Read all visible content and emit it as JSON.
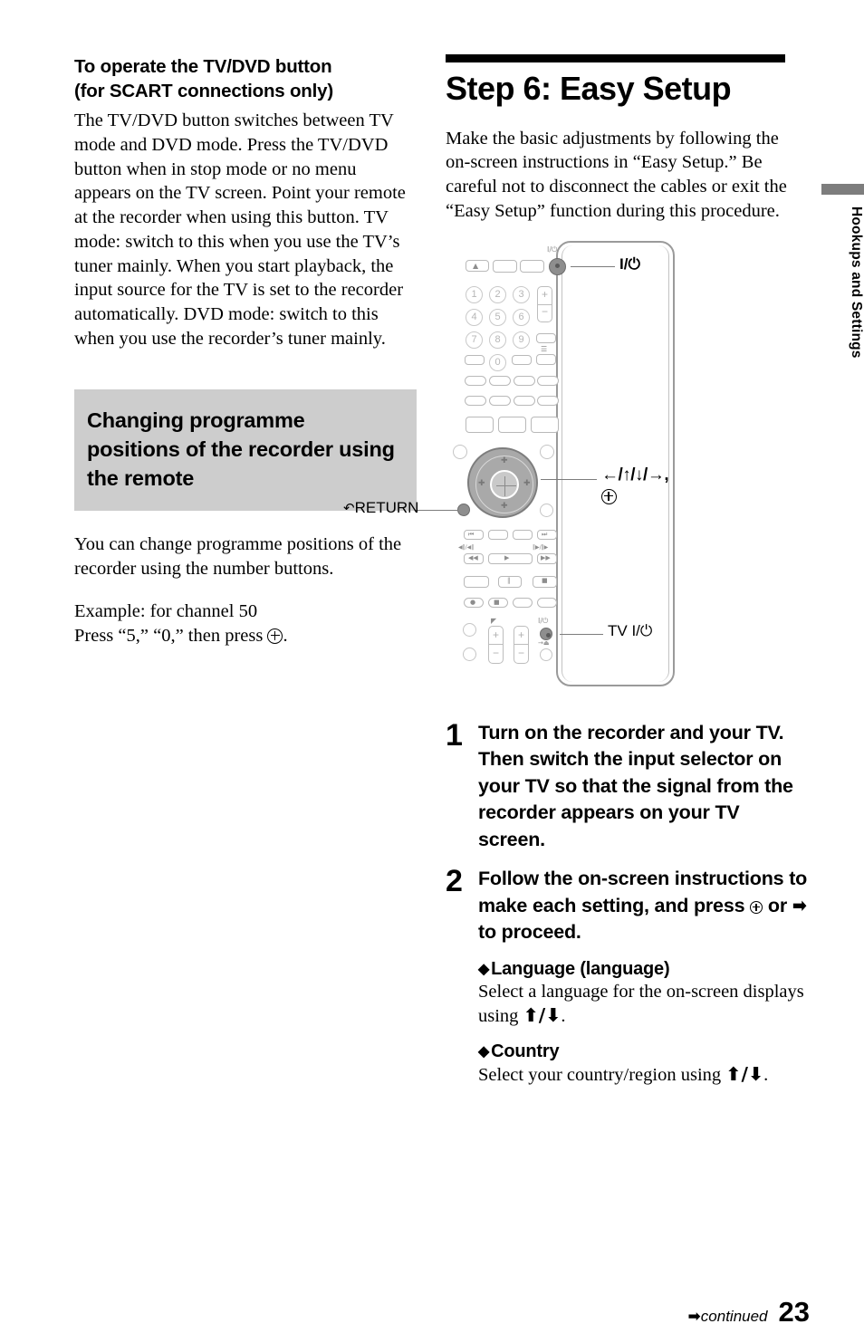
{
  "left_column": {
    "heading_line1": "To operate the TV/DVD button",
    "heading_line2": "(for SCART connections only)",
    "body": "The TV/DVD button switches between TV mode and DVD mode. Press the TV/DVD button when in stop mode or no menu appears on the TV screen. Point your remote at the recorder when using this button. TV mode: switch to this when you use the TV’s tuner mainly. When you start playback, the input source for the TV is set to the recorder automatically. DVD mode: switch to this when you use the recorder’s tuner mainly.",
    "gray_box_title": "Changing programme positions of the recorder using the remote",
    "after_box_para": "You can change programme positions of the recorder using the number buttons.",
    "example_line1": "Example: for channel 50",
    "example_line2_pre": "Press “5,” “0,” then press ",
    "example_line2_post": "."
  },
  "right_column": {
    "step_title": "Step 6: Easy Setup",
    "intro": "Make the basic adjustments by following the on-screen instructions in “Easy Setup.” Be careful not to disconnect the cables or exit the “Easy Setup” function during this procedure."
  },
  "figure": {
    "callout_power": "I/⏻",
    "callout_return": "RETURN",
    "callout_dpad_arrows": "←/↑/↓/→,",
    "callout_tv_power": "TV I/⏻",
    "remote_numbers": [
      "1",
      "2",
      "3",
      "4",
      "5",
      "6",
      "7",
      "8",
      "9",
      "0"
    ],
    "rocker_plus": "+",
    "rocker_minus": "−",
    "power_glyph": "I/⏻",
    "eject_glyph": "▲",
    "transport_prev": "⏮",
    "transport_next": "⏭",
    "transport_rew": "◀◀",
    "transport_play": "▶",
    "transport_ff": "▶▶",
    "transport_pause": "‖",
    "transport_stop": "■",
    "transport_rec": "●",
    "scan_back_label": "◀‖/◀‖",
    "scan_fwd_label": "‖▶/‖▶",
    "input_glyph": "→⏏"
  },
  "steps": [
    {
      "number": "1",
      "text": "Turn on the recorder and your TV. Then switch the input selector on your TV so that the signal from the recorder appears on your TV screen."
    },
    {
      "number": "2",
      "text_part1": "Follow the on-screen instructions to make each setting, and press ",
      "text_part2": " or ",
      "arrow": "➡",
      "text_part3": " to proceed."
    }
  ],
  "bullets": [
    {
      "marker": "◆",
      "heading": "Language (language)",
      "body_pre": "Select a language for the on-screen displays using ",
      "arrows": "⬆/⬇",
      "body_post": "."
    },
    {
      "marker": "◆",
      "heading": "Country",
      "body_pre": "Select your country/region using ",
      "arrows": "⬆/⬇",
      "body_post": "."
    }
  ],
  "side_tab": {
    "label": "Hookups and Settings"
  },
  "footer": {
    "continued_arrow": "➡",
    "continued": "continued",
    "page_number": "23"
  }
}
